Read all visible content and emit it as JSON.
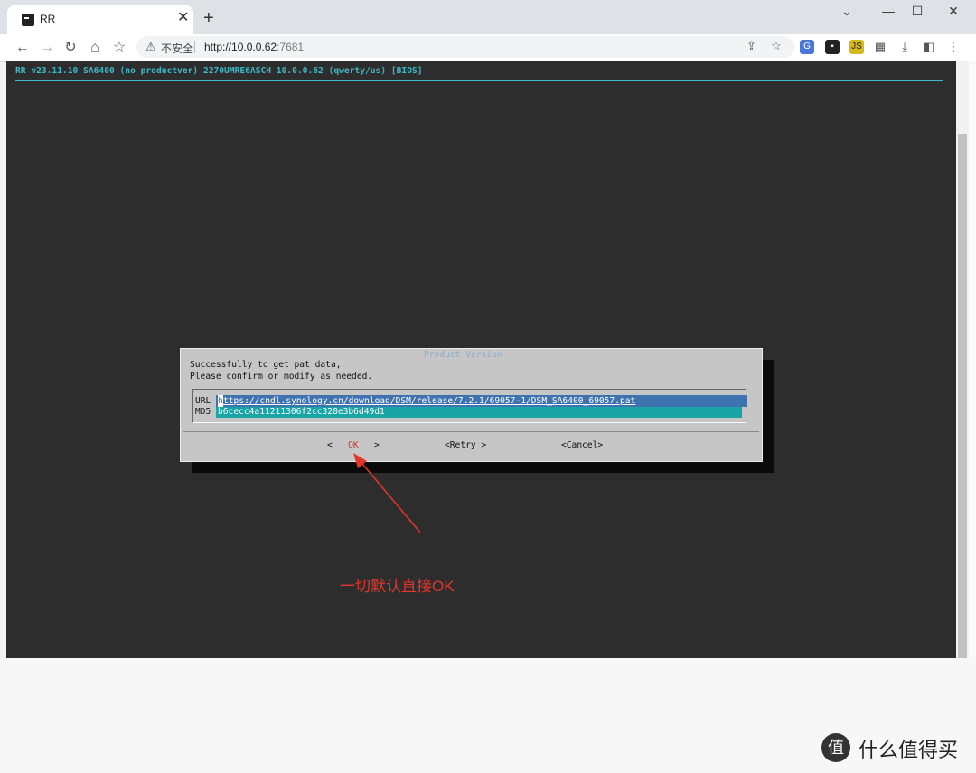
{
  "browser": {
    "tab_title": "RR",
    "tab_close": "✕",
    "new_tab": "+",
    "window_controls": [
      "⌄",
      "—",
      "☐",
      "✕"
    ],
    "insecure_label": "不安全",
    "url_host": "http://10.0.0.62",
    "url_port": ":7681"
  },
  "terminal": {
    "header": "RR v23.11.10 SA6400 (no productver) 2270UMRE6ASCH 10.0.0.62 (qwerty/us) [BIOS]"
  },
  "dialog": {
    "title": "Product Version",
    "message_line1": "Successfully to get pat data,",
    "message_line2": "Please confirm or modify as needed.",
    "url_label": "URL",
    "url_cursor_char": "h",
    "url_value_rest": "ttps://cndl.synology.cn/download/DSM/release/7.2.1/69057-1/DSM_SA6400_69057.pat",
    "md5_label": "MD5",
    "md5_value": "b6cecc4a11211306f2cc328e3b6d49d1",
    "ok_left": "<",
    "ok_text": "OK",
    "ok_right": ">",
    "retry_button": "<Retry >",
    "cancel_button": "<Cancel>"
  },
  "annotation": {
    "text": "一切默认直接OK",
    "color": "#e5352c"
  },
  "watermark": {
    "logo_char": "值",
    "text": "什么值得买"
  }
}
